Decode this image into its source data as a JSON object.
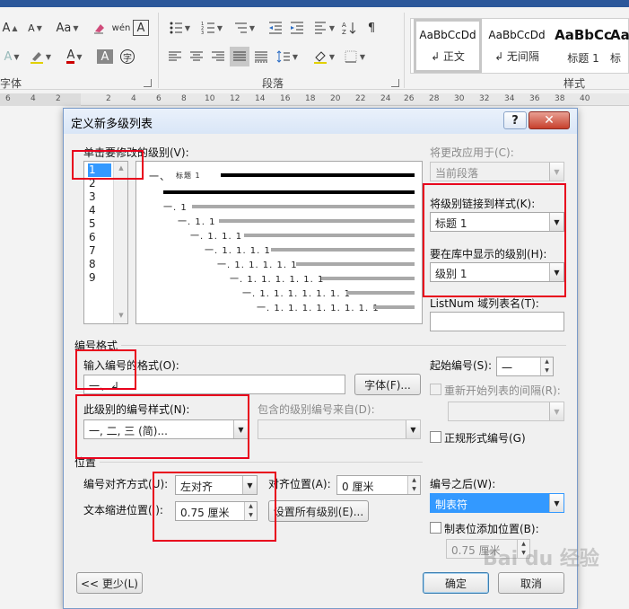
{
  "ribbon": {
    "font_group_label": "字体",
    "paragraph_group_label": "段落",
    "styles_group_label": "样式",
    "styles": [
      {
        "sample": "AaBbCcDd",
        "name": "↲ 正文"
      },
      {
        "sample": "AaBbCcDd",
        "name": "↲ 无间隔"
      },
      {
        "sample": "AaBbCc",
        "name": "标题 1"
      },
      {
        "sample": "AaBb",
        "name": "标"
      }
    ]
  },
  "ruler": {
    "numbers": [
      "6",
      "4",
      "2",
      "2",
      "4",
      "6",
      "8",
      "10",
      "12",
      "14",
      "16",
      "18",
      "20",
      "22",
      "24",
      "26",
      "28",
      "30",
      "32",
      "34",
      "36",
      "38",
      "40"
    ]
  },
  "dialog": {
    "title": "定义新多级列表",
    "help": "?",
    "close": "✕",
    "level_label": "单击要修改的级别(V):",
    "levels": [
      "1",
      "2",
      "3",
      "4",
      "5",
      "6",
      "7",
      "8",
      "9"
    ],
    "preview": {
      "heading_text": "一、",
      "heading_style": "标题 1",
      "rows": [
        "一. 1",
        "一. 1. 1",
        "一. 1. 1. 1",
        "一. 1. 1. 1. 1",
        "一. 1. 1. 1. 1. 1",
        "一. 1. 1. 1. 1. 1. 1",
        "一. 1. 1. 1. 1. 1. 1. 1",
        "一. 1. 1. 1. 1. 1. 1. 1. 1"
      ]
    },
    "apply_to_label": "将更改应用于(C):",
    "apply_to_value": "当前段落",
    "link_style_label": "将级别链接到样式(K):",
    "link_style_value": "标题 1",
    "gallery_level_label": "要在库中显示的级别(H):",
    "gallery_level_value": "级别 1",
    "listnum_label": "ListNum 域列表名(T):",
    "listnum_value": "",
    "number_format_section": "编号格式",
    "enter_format_label": "输入编号的格式(O):",
    "enter_format_value": "一、↲",
    "font_button": "字体(F)...",
    "number_style_label": "此级别的编号样式(N):",
    "number_style_value": "一, 二, 三 (简)...",
    "include_level_label": "包含的级别编号来自(D):",
    "include_level_value": "",
    "start_at_label": "起始编号(S):",
    "start_at_value": "一",
    "restart_label": "重新开始列表的间隔(R):",
    "restart_value": "",
    "legal_label": "正规形式编号(G)",
    "position_section": "位置",
    "alignment_label": "编号对齐方式(U):",
    "alignment_value": "左对齐",
    "aligned_at_label": "对齐位置(A):",
    "aligned_at_value": "0 厘米",
    "indent_label": "文本缩进位置(I):",
    "indent_value": "0.75 厘米",
    "set_all_button": "设置所有级别(E)...",
    "follow_label": "编号之后(W):",
    "follow_value": "制表符",
    "tab_stop_label": "制表位添加位置(B):",
    "tab_stop_value": "0.75 厘米",
    "less_button": "<< 更少(L)",
    "ok_button": "确定",
    "cancel_button": "取消"
  },
  "watermark": "Bai du 经验",
  "colors": {
    "accent": "#2b579a",
    "highlight": "#e8001c",
    "selection": "#3399ff"
  }
}
